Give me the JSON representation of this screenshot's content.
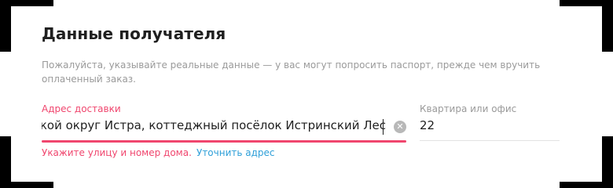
{
  "form": {
    "title": "Данные получателя",
    "hint": "Пожалуйста, указывайте реальные данные — у вас могут попросить паспорт, прежде чем вручить оплаченный заказ."
  },
  "address_field": {
    "label": "Адрес доставки",
    "value": "ской округ Истра, коттеджный посёлок Истринский Лес",
    "clear_icon": "clear-icon",
    "accent_color": "#f0466e"
  },
  "apartment_field": {
    "label": "Квартира или офис",
    "value": "22"
  },
  "validation": {
    "error_text": "Укажите улицу и номер дома.",
    "refine_link": "Уточнить адрес",
    "error_color": "#f0466e",
    "link_color": "#2e9fd8"
  }
}
